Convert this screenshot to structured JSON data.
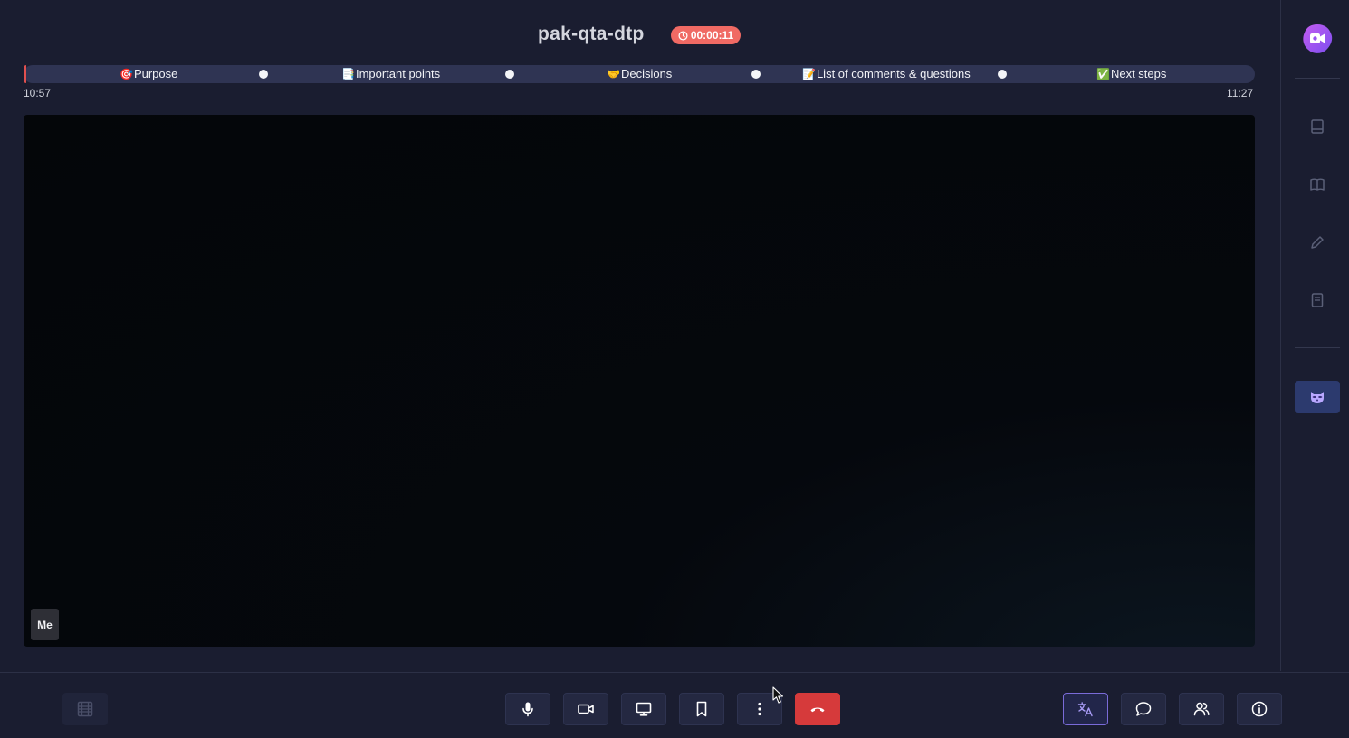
{
  "meeting": {
    "title": "pak-qta-dtp",
    "elapsed": "00:00:11"
  },
  "agenda": {
    "progress_fraction": 0.001,
    "start_time": "10:57",
    "end_time": "11:27",
    "items": [
      {
        "emoji": "🎯",
        "label": "Purpose"
      },
      {
        "emoji": "📑",
        "label": "Important points"
      },
      {
        "emoji": "🤝",
        "label": "Decisions"
      },
      {
        "emoji": "📝",
        "label": "List of comments & questions"
      },
      {
        "emoji": "✅",
        "label": "Next steps"
      }
    ]
  },
  "video": {
    "participant_label": "Me"
  },
  "sidebar": {
    "items": [
      {
        "icon": "app-logo-icon"
      },
      {
        "icon": "notebook-icon"
      },
      {
        "icon": "book-open-icon"
      },
      {
        "icon": "pencil-icon"
      },
      {
        "icon": "document-icon"
      },
      {
        "icon": "raccoon-icon"
      }
    ]
  },
  "toolbar": {
    "left": [
      {
        "icon": "film-grid-icon"
      }
    ],
    "center": [
      {
        "icon": "microphone-icon"
      },
      {
        "icon": "camera-icon"
      },
      {
        "icon": "screen-share-icon"
      },
      {
        "icon": "bookmark-icon"
      },
      {
        "icon": "more-vertical-icon"
      },
      {
        "icon": "hang-up-icon"
      }
    ],
    "right": [
      {
        "icon": "translate-icon"
      },
      {
        "icon": "chat-icon"
      },
      {
        "icon": "participants-icon"
      },
      {
        "icon": "info-icon"
      }
    ]
  },
  "colors": {
    "background": "#1a1d30",
    "agenda_bar": "#2f3453",
    "timer_badge": "#f06a64",
    "hangup": "#d63a3b",
    "accent": "#7a6bd8"
  }
}
